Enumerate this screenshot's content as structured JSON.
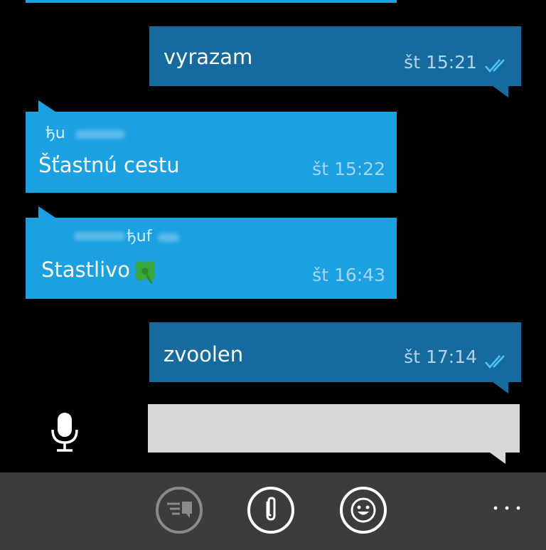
{
  "messages": [
    {
      "direction": "outgoing",
      "text": "vyrazam",
      "time": "št 15:21",
      "status": "double-check"
    },
    {
      "direction": "incoming",
      "sender": "ђu",
      "text": "Šťastnú cestu",
      "time": "št 15:22"
    },
    {
      "direction": "incoming",
      "sender": "ђuf",
      "text": "Stastlivo",
      "emoji": "four-leaf-clover-icon",
      "time": "št 16:43"
    },
    {
      "direction": "outgoing",
      "text": "zvoolen",
      "time": "št 17:14",
      "status": "double-check"
    }
  ],
  "compose": {
    "value": "",
    "placeholder": ""
  },
  "appbar": {
    "buttons": [
      {
        "icon": "quick-reply-icon",
        "enabled": false
      },
      {
        "icon": "attach-icon",
        "enabled": true
      },
      {
        "icon": "emoji-icon",
        "enabled": true
      }
    ],
    "more_icon": "ellipsis-icon"
  },
  "colors": {
    "background": "#000000",
    "outgoing_bubble": "#156a9e",
    "incoming_bubble": "#1ba1e2",
    "compose_box": "#d7d7d7",
    "appbar": "#3c3c3c",
    "check_mark": "#4fc3f7"
  }
}
